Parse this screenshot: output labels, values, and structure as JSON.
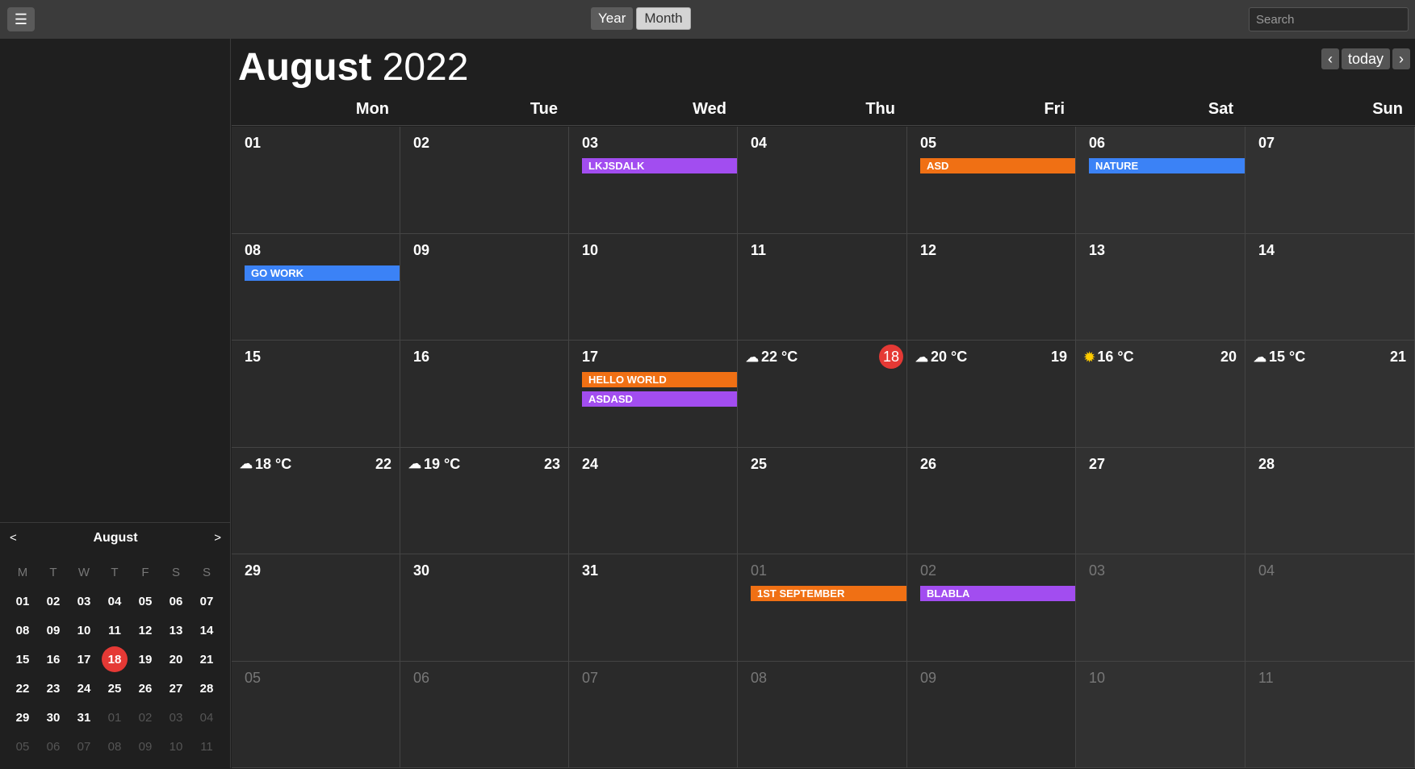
{
  "header": {
    "menu_icon": "☰",
    "views": [
      {
        "label": "Year",
        "active": false
      },
      {
        "label": "Month",
        "active": true
      }
    ],
    "search_placeholder": "Search"
  },
  "title": {
    "month": "August",
    "year": "2022"
  },
  "nav": {
    "prev": "‹",
    "today": "today",
    "next": "›"
  },
  "weekdays": [
    "Mon",
    "Tue",
    "Wed",
    "Thu",
    "Fri",
    "Sat",
    "Sun"
  ],
  "colors": {
    "purple": "#a24df0",
    "orange": "#f07014",
    "blue": "#3b82f6",
    "today": "#e53935"
  },
  "weeks": [
    [
      {
        "label": "01"
      },
      {
        "label": "02"
      },
      {
        "label": "03",
        "events": [
          {
            "title": "LKJSDALK",
            "color": "purple"
          }
        ]
      },
      {
        "label": "04"
      },
      {
        "label": "05",
        "events": [
          {
            "title": "ASD",
            "color": "orange"
          }
        ]
      },
      {
        "label": "06",
        "events": [
          {
            "title": "NATURE",
            "color": "blue"
          }
        ]
      },
      {
        "label": "07"
      }
    ],
    [
      {
        "label": "08",
        "events": [
          {
            "title": "GO WORK",
            "color": "blue"
          }
        ]
      },
      {
        "label": "09"
      },
      {
        "label": "10"
      },
      {
        "label": "11"
      },
      {
        "label": "12"
      },
      {
        "label": "13"
      },
      {
        "label": "14"
      }
    ],
    [
      {
        "label": "15"
      },
      {
        "label": "16"
      },
      {
        "label": "17",
        "events": [
          {
            "title": "HELLO WORLD",
            "color": "orange"
          },
          {
            "title": "ASDASD",
            "color": "purple"
          }
        ]
      },
      {
        "label": "18",
        "today": true,
        "weather": {
          "icon": "cloud",
          "temp": "22 °C"
        }
      },
      {
        "label": "19",
        "weather": {
          "icon": "cloud",
          "temp": "20 °C"
        }
      },
      {
        "label": "20",
        "weather": {
          "icon": "sun",
          "temp": "16 °C"
        }
      },
      {
        "label": "21",
        "weather": {
          "icon": "cloud",
          "temp": "15 °C"
        }
      }
    ],
    [
      {
        "label": "22",
        "weather": {
          "icon": "cloud",
          "temp": "18 °C"
        }
      },
      {
        "label": "23",
        "weather": {
          "icon": "cloud",
          "temp": "19 °C"
        }
      },
      {
        "label": "24"
      },
      {
        "label": "25"
      },
      {
        "label": "26"
      },
      {
        "label": "27"
      },
      {
        "label": "28"
      }
    ],
    [
      {
        "label": "29"
      },
      {
        "label": "30"
      },
      {
        "label": "31"
      },
      {
        "label": "01",
        "other": true,
        "events": [
          {
            "title": "1ST SEPTEMBER",
            "color": "orange"
          }
        ]
      },
      {
        "label": "02",
        "other": true,
        "events": [
          {
            "title": "BLABLA",
            "color": "purple"
          }
        ]
      },
      {
        "label": "03",
        "other": true
      },
      {
        "label": "04",
        "other": true
      }
    ],
    [
      {
        "label": "05",
        "other": true
      },
      {
        "label": "06",
        "other": true
      },
      {
        "label": "07",
        "other": true
      },
      {
        "label": "08",
        "other": true
      },
      {
        "label": "09",
        "other": true
      },
      {
        "label": "10",
        "other": true
      },
      {
        "label": "11",
        "other": true
      }
    ]
  ],
  "mini": {
    "month": "August",
    "prev": "<",
    "next": ">",
    "weekdays": [
      "M",
      "T",
      "W",
      "T",
      "F",
      "S",
      "S"
    ],
    "days": [
      {
        "label": "01"
      },
      {
        "label": "02"
      },
      {
        "label": "03"
      },
      {
        "label": "04"
      },
      {
        "label": "05"
      },
      {
        "label": "06"
      },
      {
        "label": "07"
      },
      {
        "label": "08"
      },
      {
        "label": "09"
      },
      {
        "label": "10"
      },
      {
        "label": "11"
      },
      {
        "label": "12"
      },
      {
        "label": "13"
      },
      {
        "label": "14"
      },
      {
        "label": "15"
      },
      {
        "label": "16"
      },
      {
        "label": "17"
      },
      {
        "label": "18",
        "today": true
      },
      {
        "label": "19"
      },
      {
        "label": "20"
      },
      {
        "label": "21"
      },
      {
        "label": "22"
      },
      {
        "label": "23"
      },
      {
        "label": "24"
      },
      {
        "label": "25"
      },
      {
        "label": "26"
      },
      {
        "label": "27"
      },
      {
        "label": "28"
      },
      {
        "label": "29"
      },
      {
        "label": "30"
      },
      {
        "label": "31"
      },
      {
        "label": "01",
        "other": true
      },
      {
        "label": "02",
        "other": true
      },
      {
        "label": "03",
        "other": true
      },
      {
        "label": "04",
        "other": true
      },
      {
        "label": "05",
        "other": true
      },
      {
        "label": "06",
        "other": true
      },
      {
        "label": "07",
        "other": true
      },
      {
        "label": "08",
        "other": true
      },
      {
        "label": "09",
        "other": true
      },
      {
        "label": "10",
        "other": true
      },
      {
        "label": "11",
        "other": true
      }
    ]
  }
}
